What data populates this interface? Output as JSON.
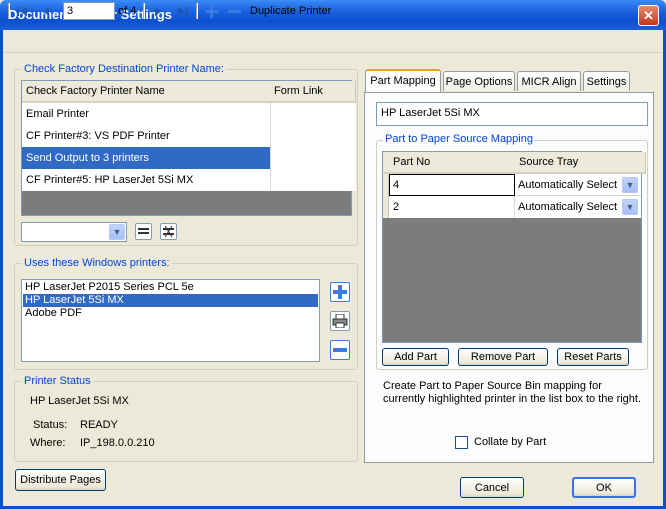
{
  "window": {
    "title": "Document Printer Settings",
    "close_glyph": "✕"
  },
  "nav": {
    "current_page": "3",
    "of_label": "of 4",
    "duplicate_label": "Duplicate Printer"
  },
  "factory": {
    "group_label": "Check Factory Destination Printer Name:",
    "columns": [
      "Check Factory Printer Name",
      "Form Link"
    ],
    "rows": [
      "Email Printer",
      "CF Printer#3: VS PDF Printer",
      "Send Output to 3 printers",
      "CF Printer#5: HP LaserJet 5Si MX"
    ],
    "selected_index": 2
  },
  "windows_printers": {
    "group_label": "Uses these Windows printers:",
    "items": [
      "HP LaserJet P2015 Series PCL 5e",
      "HP LaserJet 5Si MX",
      "Adobe PDF"
    ],
    "selected_index": 1
  },
  "status": {
    "group_label": "Printer Status",
    "printer_name": "HP LaserJet 5Si MX",
    "status_label": "Status:",
    "status_value": "READY",
    "where_label": "Where:",
    "where_value": "IP_198.0.0.210"
  },
  "distribute_button": "Distribute Pages",
  "tabs": [
    "Part Mapping",
    "Page Options",
    "MICR Align",
    "Settings"
  ],
  "active_tab": 0,
  "part_mapping": {
    "printer_field": "HP LaserJet 5Si MX",
    "group_label": "Part to Paper Source Mapping",
    "columns": [
      "Part No",
      "Source Tray"
    ],
    "rows": [
      {
        "part": "4",
        "tray": "Automatically Select"
      },
      {
        "part": "2",
        "tray": "Automatically Select"
      }
    ],
    "add_button": "Add Part",
    "remove_button": "Remove Part",
    "reset_button": "Reset Parts",
    "help_text": "Create Part to Paper Source Bin mapping for currently highlighted printer in the list box to the right.",
    "collate_label": "Collate by Part",
    "collate_checked": false
  },
  "footer": {
    "cancel": "Cancel",
    "ok": "OK"
  },
  "colors": {
    "accent": "#0046d5",
    "selection": "#316ac5",
    "title_bar": "#0a4fd0"
  }
}
